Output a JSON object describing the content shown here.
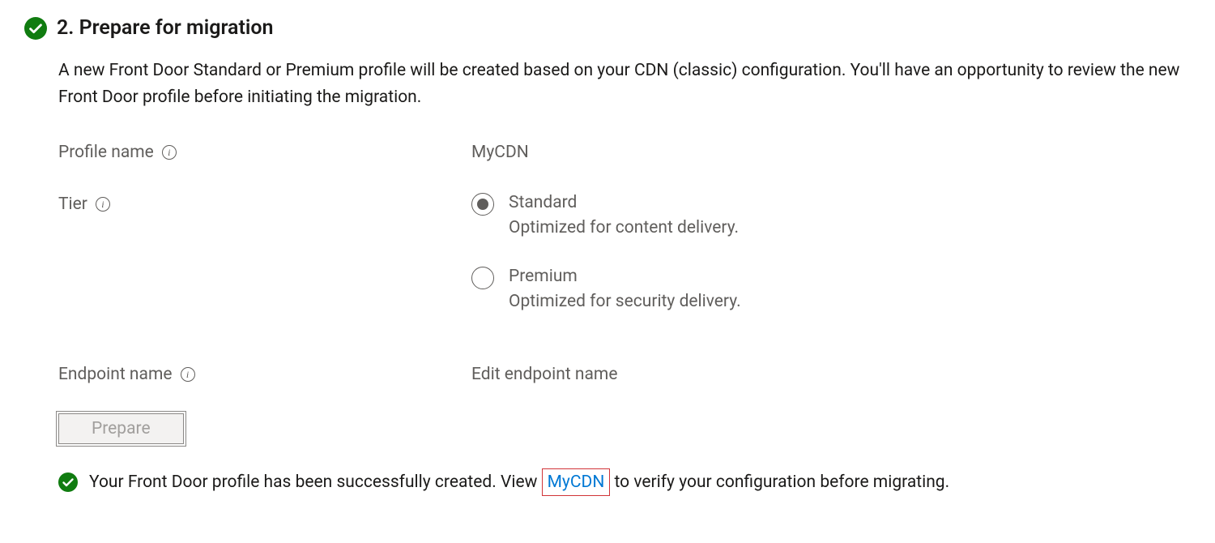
{
  "section": {
    "title": "2. Prepare for migration",
    "description": "A new Front Door Standard or Premium profile will be created based on your CDN (classic) configuration. You'll have an opportunity to review the new Front Door profile before initiating the migration."
  },
  "fields": {
    "profile_name": {
      "label": "Profile name",
      "value": "MyCDN"
    },
    "tier": {
      "label": "Tier",
      "options": [
        {
          "label": "Standard",
          "sub": "Optimized for content delivery.",
          "selected": true
        },
        {
          "label": "Premium",
          "sub": "Optimized for security delivery.",
          "selected": false
        }
      ]
    },
    "endpoint_name": {
      "label": "Endpoint name",
      "value": "Edit endpoint name"
    }
  },
  "buttons": {
    "prepare": "Prepare"
  },
  "status": {
    "prefix": "Your Front Door profile has been successfully created. View ",
    "link": "MyCDN",
    "suffix": " to verify your configuration before migrating."
  },
  "info_glyph": "i"
}
